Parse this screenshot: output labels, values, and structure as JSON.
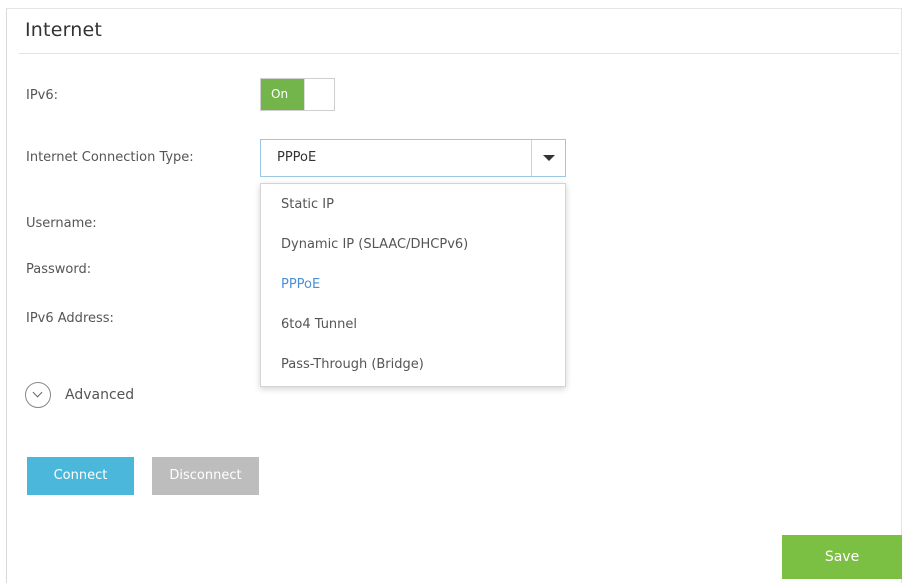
{
  "section": {
    "title": "Internet"
  },
  "form": {
    "ipv6_label": "IPv6:",
    "ipv6_toggle": {
      "state_text": "On",
      "enabled": true
    },
    "connection_type_label": "Internet Connection Type:",
    "connection_type_value": "PPPoE",
    "username_label": "Username:",
    "password_label": "Password:",
    "ipv6_address_label": "IPv6 Address:"
  },
  "dropdown": {
    "options": [
      {
        "label": "Static IP",
        "selected": false
      },
      {
        "label": "Dynamic IP (SLAAC/DHCPv6)",
        "selected": false
      },
      {
        "label": "PPPoE",
        "selected": true
      },
      {
        "label": "6to4 Tunnel",
        "selected": false
      },
      {
        "label": "Pass-Through (Bridge)",
        "selected": false
      }
    ]
  },
  "advanced": {
    "label": "Advanced",
    "icon": "chevron-down-circle-icon"
  },
  "buttons": {
    "connect": "Connect",
    "disconnect": "Disconnect",
    "save": "Save"
  },
  "colors": {
    "toggle_on": "#73b54a",
    "connect": "#4ab7db",
    "disconnect": "#bdbdbd",
    "save": "#7bc043",
    "selected_option": "#4a90d9"
  }
}
